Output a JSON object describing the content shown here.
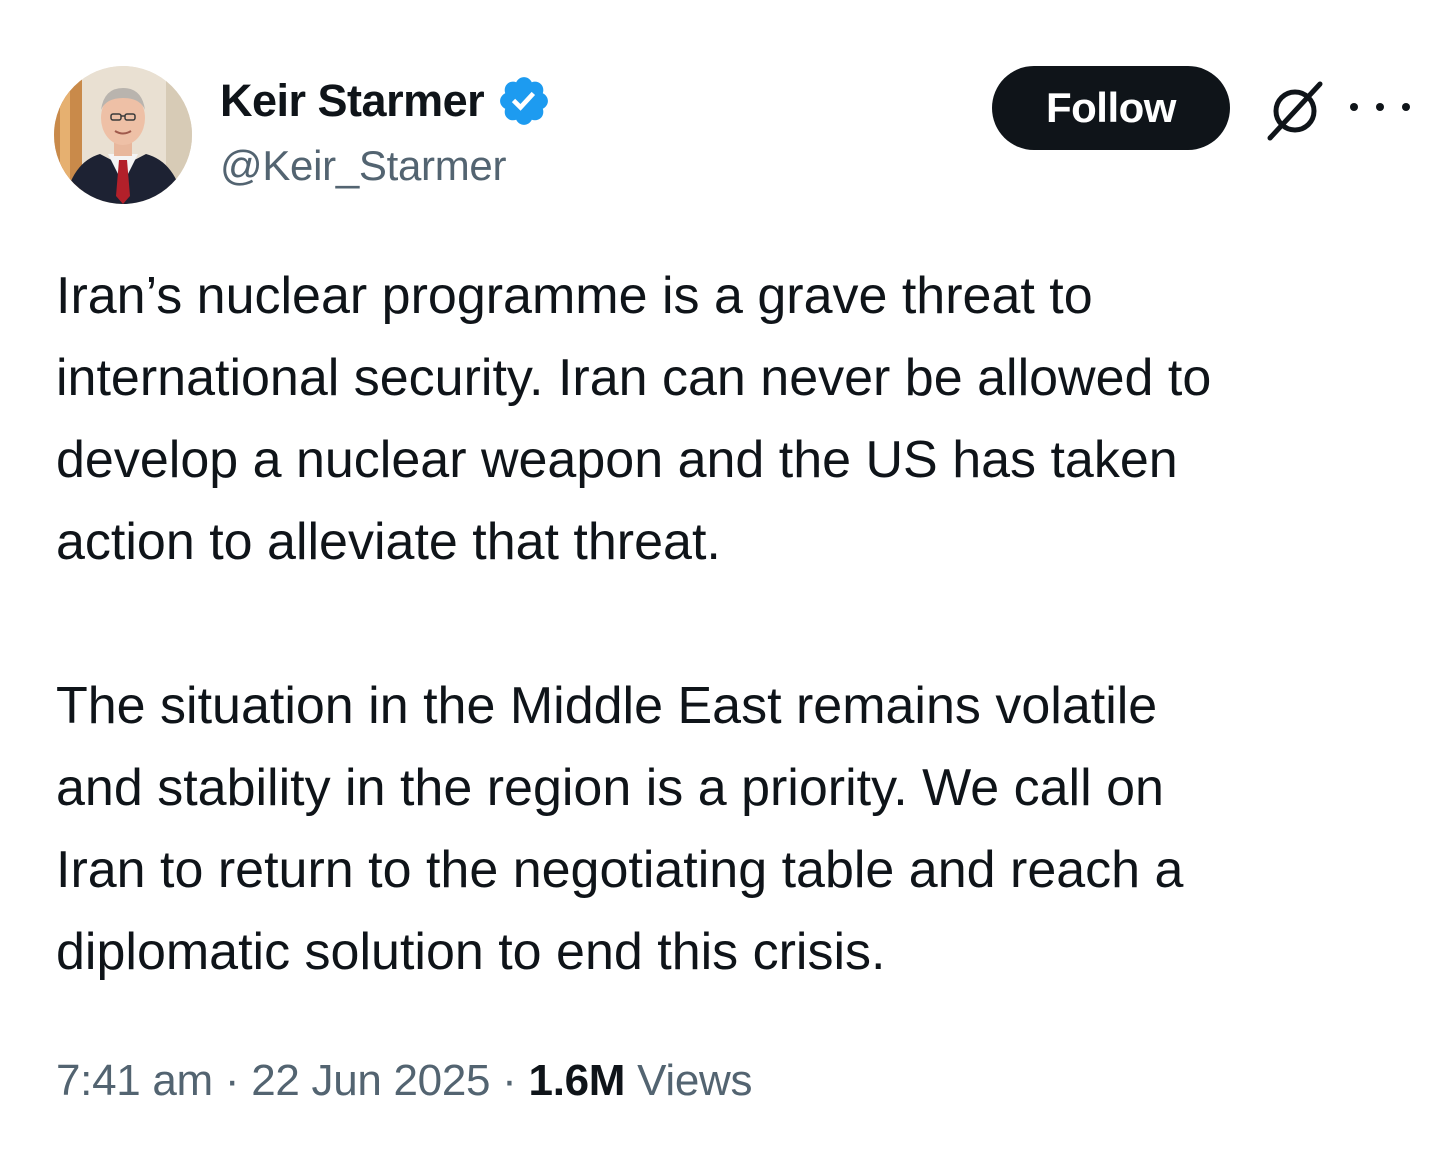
{
  "author": {
    "display_name": "Keir Starmer",
    "handle": "@Keir_Starmer",
    "verified": true,
    "verified_color": "#1d9bf0"
  },
  "actions": {
    "follow_label": "Follow",
    "grok_icon": "grok-icon",
    "more_icon": "more-icon"
  },
  "tweet": {
    "paragraph1": [
      "Iran’s nuclear programme is a grave threat to",
      "international security. Iran can never be allowed to",
      "develop a nuclear weapon and the US has taken",
      "action to alleviate that threat."
    ],
    "paragraph2": [
      "The situation in the Middle East remains volatile",
      "and stability in the region is a priority. We call on",
      "Iran to return to the negotiating table and reach a",
      "diplomatic solution to end this crisis."
    ]
  },
  "meta": {
    "time": "7:41 am",
    "separator": "·",
    "date": "22 Jun 2025",
    "views_count": "1.6M",
    "views_label": "Views"
  }
}
